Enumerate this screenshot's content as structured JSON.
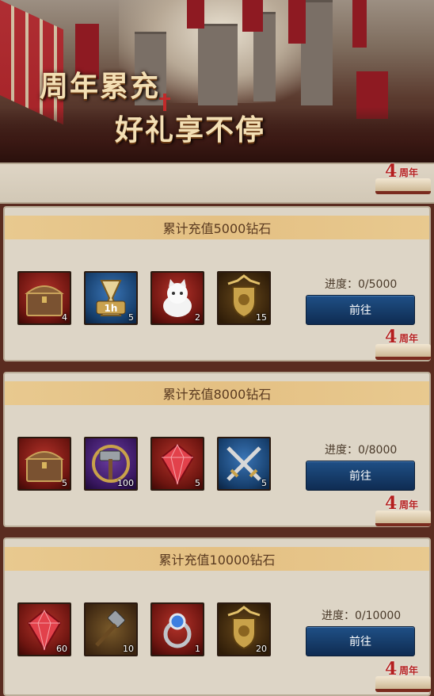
{
  "banner": {
    "line1": "周年累充",
    "line2": "好礼享不停"
  },
  "badge": {
    "number": "4",
    "label": "周年"
  },
  "tiers": [
    {
      "title": "累计充值5000钻石",
      "progress": "进度：0/5000",
      "button": "前往",
      "items": [
        {
          "icon": "treasure-chest-icon",
          "qty": "4"
        },
        {
          "icon": "hourglass-1h-icon",
          "qty": "5"
        },
        {
          "icon": "white-cat-icon",
          "qty": "2"
        },
        {
          "icon": "gold-crest-icon",
          "qty": "15"
        }
      ]
    },
    {
      "title": "累计充值8000钻石",
      "progress": "进度：0/8000",
      "button": "前往",
      "items": [
        {
          "icon": "treasure-chest-icon",
          "qty": "5"
        },
        {
          "icon": "hammer-icon",
          "qty": "100"
        },
        {
          "icon": "red-gem-icon",
          "qty": "5"
        },
        {
          "icon": "crossed-swords-icon",
          "qty": "5"
        }
      ]
    },
    {
      "title": "累计充值10000钻石",
      "progress": "进度：0/10000",
      "button": "前往",
      "items": [
        {
          "icon": "red-gem-icon",
          "qty": "60"
        },
        {
          "icon": "war-hammer-icon",
          "qty": "10"
        },
        {
          "icon": "sapphire-ring-icon",
          "qty": "1"
        },
        {
          "icon": "gold-crest-icon",
          "qty": "20"
        }
      ]
    }
  ]
}
